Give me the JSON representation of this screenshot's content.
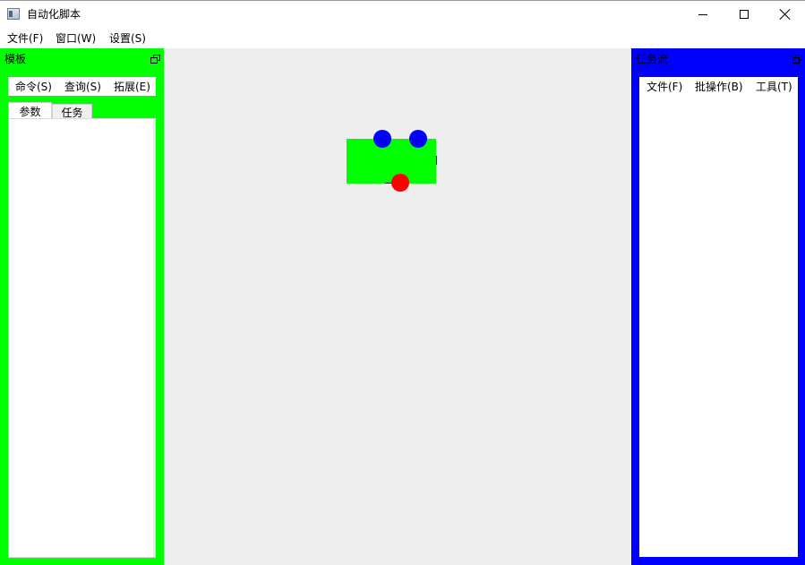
{
  "window": {
    "title": "自动化脚本",
    "icon": "app-window-icon",
    "controls": [
      "minimize-icon",
      "maximize-icon",
      "close-icon"
    ]
  },
  "menubar": {
    "items": [
      {
        "label": "文件(F)"
      },
      {
        "label": "窗口(W)"
      },
      {
        "label": "设置(S)"
      }
    ]
  },
  "left_dock": {
    "title": "模板",
    "background": "#00ff00",
    "menu": [
      {
        "label": "命令(S)"
      },
      {
        "label": "查询(S)"
      },
      {
        "label": "拓展(E)"
      }
    ],
    "tabs": [
      {
        "label": "参数",
        "selected": true
      },
      {
        "label": "任务",
        "selected": false
      }
    ]
  },
  "right_dock": {
    "title": "任务流",
    "background": "#0000ff",
    "menu": [
      {
        "label": "文件(F)"
      },
      {
        "label": "批操作(B)"
      },
      {
        "label": "工具(T)"
      }
    ]
  },
  "canvas": {
    "background": "#eeeeee",
    "node": {
      "color": "#00ff00",
      "input_ports": [
        "#0000ff",
        "#0000ff"
      ],
      "output_port": "#ff0000"
    }
  }
}
